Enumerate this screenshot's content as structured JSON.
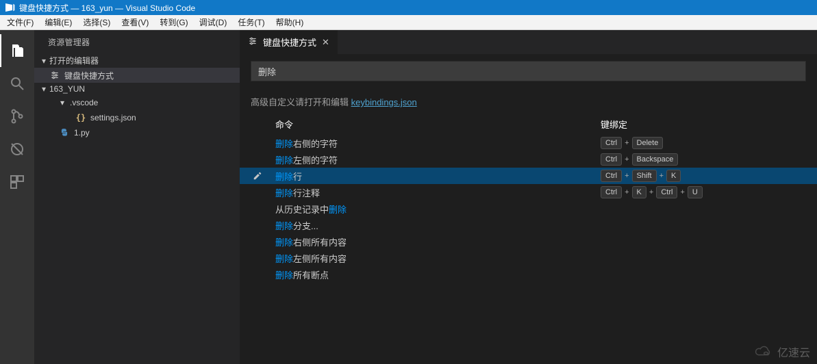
{
  "titlebar": {
    "text": "键盘快捷方式 — 163_yun — Visual Studio Code"
  },
  "menubar": {
    "items": [
      "文件(F)",
      "编辑(E)",
      "选择(S)",
      "查看(V)",
      "转到(G)",
      "调试(D)",
      "任务(T)",
      "帮助(H)"
    ]
  },
  "sidebar": {
    "header": "资源管理器",
    "open_editors_label": "打开的编辑器",
    "open_editors": [
      {
        "label": "键盘快捷方式"
      }
    ],
    "workspace_label": "163_YUN",
    "tree": {
      "vscode_label": ".vscode",
      "settings_label": "settings.json",
      "py_label": "1.py"
    }
  },
  "tab": {
    "label": "键盘快捷方式"
  },
  "search": {
    "value": "删除"
  },
  "hint": {
    "prefix": "高级自定义请打开和编辑 ",
    "link": "keybindings.json"
  },
  "columns": {
    "cmd": "命令",
    "key": "键绑定"
  },
  "rows": [
    {
      "pre": "",
      "hl": "删除",
      "post": "右侧的字符",
      "keys": [
        "Ctrl",
        "Delete"
      ]
    },
    {
      "pre": "",
      "hl": "删除",
      "post": "左侧的字符",
      "keys": [
        "Ctrl",
        "Backspace"
      ]
    },
    {
      "pre": "",
      "hl": "删除",
      "post": "行",
      "keys": [
        "Ctrl",
        "Shift",
        "K"
      ],
      "selected": true
    },
    {
      "pre": "",
      "hl": "删除",
      "post": "行注释",
      "keys": [
        "Ctrl",
        "K",
        "Ctrl",
        "U"
      ]
    },
    {
      "pre": "从历史记录中",
      "hl": "删除",
      "post": "",
      "keys": []
    },
    {
      "pre": "",
      "hl": "删除",
      "post": "分支...",
      "keys": []
    },
    {
      "pre": "",
      "hl": "删除",
      "post": "右侧所有内容",
      "keys": []
    },
    {
      "pre": "",
      "hl": "删除",
      "post": "左侧所有内容",
      "keys": []
    },
    {
      "pre": "",
      "hl": "删除",
      "post": "所有断点",
      "keys": []
    }
  ],
  "watermark": "亿速云"
}
